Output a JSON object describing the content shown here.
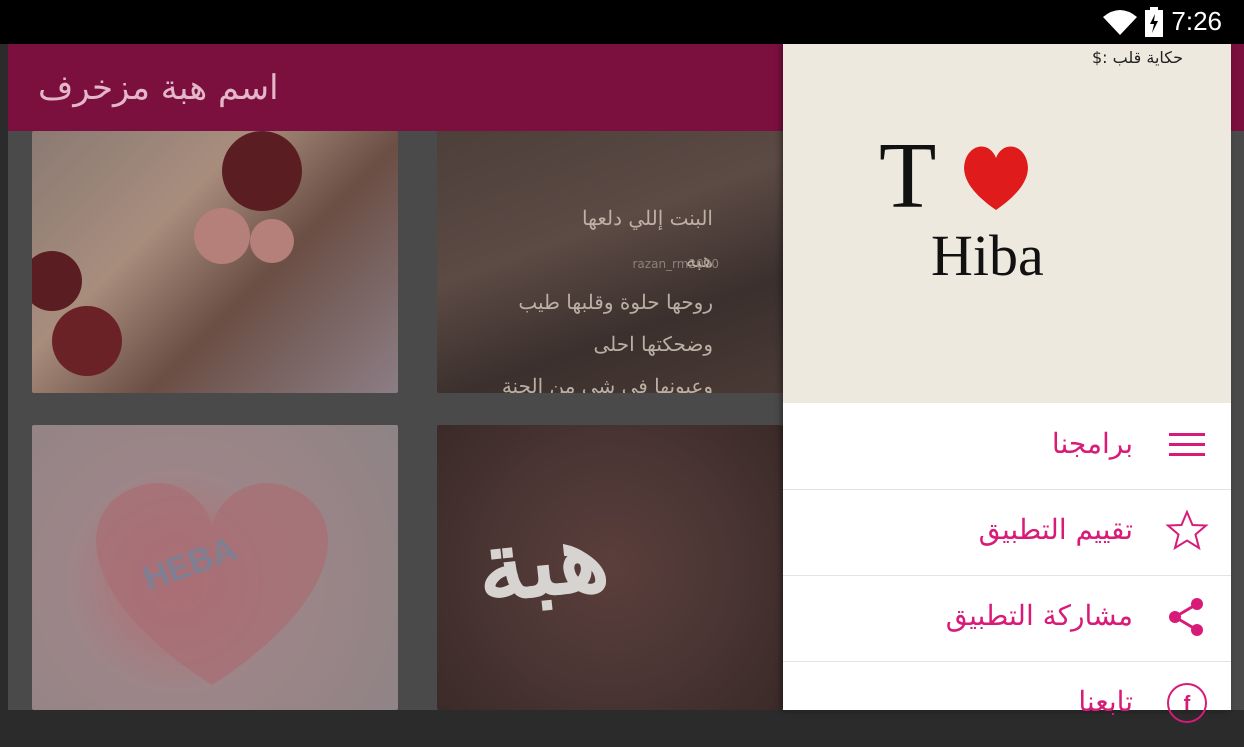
{
  "status_bar": {
    "time": "7:26",
    "wifi_icon": "wifi-icon",
    "battery_icon": "battery-charging-icon"
  },
  "app_bar": {
    "title": "اسم هبة مزخرف"
  },
  "grid": {
    "tiles": [
      {
        "name": "roses-teacup-image"
      },
      {
        "name": "girl-poem-image",
        "lines": [
          "البنت إللي دلعها",
          "هبه",
          "روحها حلوة وقلبها طيب",
          "وضحكتها احلى",
          "وعيونها في شي من الجنة"
        ],
        "watermark": "razan_rm2000"
      },
      {
        "name": "heba-heart-image",
        "text": "HEBA"
      },
      {
        "name": "heba-roses-image",
        "text": "هبة"
      }
    ]
  },
  "drawer": {
    "header": {
      "caption": "حكاية قلب :$",
      "letter": "T",
      "name": "Hiba"
    },
    "items": [
      {
        "label": "برامجنا",
        "icon": "menu-icon"
      },
      {
        "label": "تقييم التطبيق",
        "icon": "star-icon"
      },
      {
        "label": "مشاركة التطبيق",
        "icon": "share-icon"
      },
      {
        "label": "تابعنا",
        "icon": "facebook-icon"
      }
    ],
    "accent": "#d81b78"
  }
}
